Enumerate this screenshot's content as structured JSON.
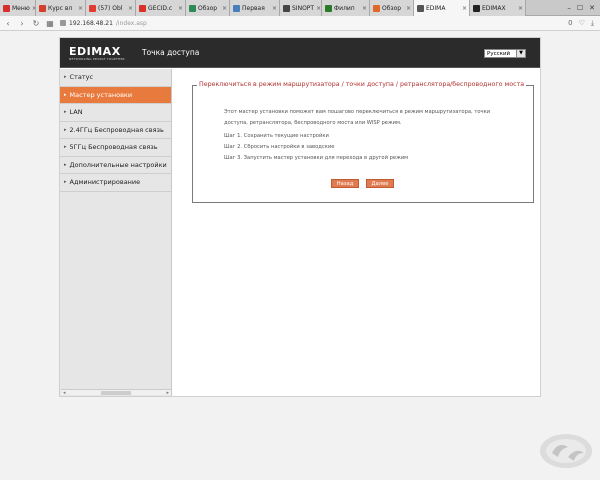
{
  "browser": {
    "tabs": [
      {
        "label": "Меню",
        "color": "#d62d2d"
      },
      {
        "label": "Курс вл",
        "color": "#d43f2a"
      },
      {
        "label": "(57) Obl",
        "color": "#e23b2f"
      },
      {
        "label": "GECID.c",
        "color": "#d9312a"
      },
      {
        "label": "Обзор",
        "color": "#2e8b57"
      },
      {
        "label": "Первая",
        "color": "#4a7ebb"
      },
      {
        "label": "SINOPT",
        "color": "#444444"
      },
      {
        "label": "Филип",
        "color": "#2a7a2a"
      },
      {
        "label": "Обзор",
        "color": "#e0692a"
      },
      {
        "label": "EDIMA",
        "color": "#555555"
      },
      {
        "label": "EDIMAX",
        "color": "#222222"
      }
    ],
    "active_tab": 9,
    "url_host": "192.168.48.21",
    "url_path": "/index.asp",
    "badge_count": "0"
  },
  "router": {
    "logo_text": "EDIMAX",
    "logo_tagline": "NETWORKING PEOPLE TOGETHER",
    "product_name": "Точка доступа",
    "language": "Русский"
  },
  "sidebar": {
    "items": [
      {
        "label": "Статус"
      },
      {
        "label": "Мастер установки"
      },
      {
        "label": "LAN"
      },
      {
        "label": "2.4ГГц Беспроводная связь"
      },
      {
        "label": "5ГГц Беспроводная связь"
      },
      {
        "label": "Дополнительные настройки"
      },
      {
        "label": "Администрирование"
      }
    ],
    "active_index": 1
  },
  "wizard": {
    "title": "Переключиться в режим маршрутизатора / точки доступа / ретранслятора/беспроводного моста",
    "intro": "Этот мастер установки поможет вам пошагово переключиться в режим маршрутизатора, точки доступа, ретранслятора, беспроводного моста или WISP режим.",
    "steps": [
      "Шаг 1. Сохранить текущие настройки",
      "Шаг 2. Сбросить настройки в заводские",
      "Шаг 3. Запустить мастер установки для перехода в другой режим"
    ],
    "back_label": "Назад",
    "next_label": "Далее"
  },
  "colors": {
    "accent": "#e97a3e",
    "title_red": "#b0322f",
    "header_dark": "#2b2b2b"
  }
}
